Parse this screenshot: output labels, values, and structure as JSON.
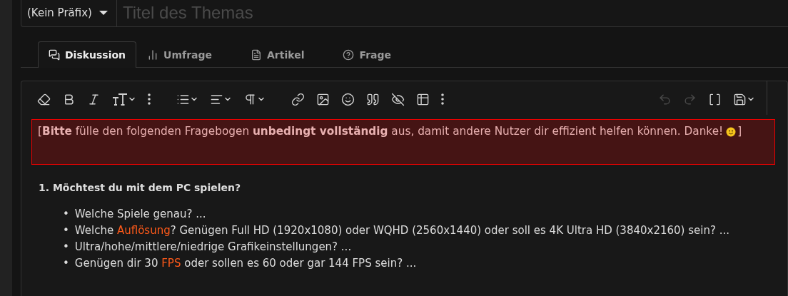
{
  "prefix_select": {
    "label": "(Kein Präfix)"
  },
  "title_field": {
    "placeholder": "Titel des Themas"
  },
  "tabs": [
    {
      "label": "Diskussion",
      "kind": "discussion",
      "selected": true
    },
    {
      "label": "Umfrage",
      "kind": "poll",
      "selected": false
    },
    {
      "label": "Artikel",
      "kind": "article",
      "selected": false
    },
    {
      "label": "Frage",
      "kind": "question",
      "selected": false
    }
  ],
  "toolbar_left": [
    {
      "kind": "eraser"
    },
    {
      "kind": "bold"
    },
    {
      "kind": "italic"
    },
    {
      "kind": "textsize",
      "dropdown": true
    },
    {
      "kind": "more"
    },
    {
      "kind": "gap"
    },
    {
      "kind": "list",
      "dropdown": true
    },
    {
      "kind": "align",
      "dropdown": true
    },
    {
      "kind": "paragraph",
      "dropdown": true
    },
    {
      "kind": "gap"
    },
    {
      "kind": "link"
    },
    {
      "kind": "image"
    },
    {
      "kind": "smile"
    },
    {
      "kind": "quote"
    },
    {
      "kind": "hide"
    },
    {
      "kind": "table"
    },
    {
      "kind": "more"
    }
  ],
  "toolbar_right": [
    {
      "kind": "undo",
      "disabled": true
    },
    {
      "kind": "redo",
      "disabled": true
    },
    {
      "kind": "brackets"
    },
    {
      "kind": "save",
      "dropdown": true
    }
  ],
  "notice": {
    "open": "[",
    "text": "**Bitte** fülle den folgenden Fragebogen **unbedingt vollständig** aus, damit andere Nutzer dir effizient helfen können. Danke!",
    "close": "]"
  },
  "heading": "1. Möchtest du mit dem PC spielen?",
  "bullets": [
    {
      "marker": "•",
      "segments": [
        {
          "text": "Welche Spiele genau? ...",
          "highlight": false
        }
      ]
    },
    {
      "marker": "•",
      "segments": [
        {
          "text": "Welche ",
          "highlight": false
        },
        {
          "text": "Auflösung",
          "highlight": true
        },
        {
          "text": "? Genügen Full HD (1920x1080) oder WQHD (2560x1440) oder soll es 4K Ultra HD (3840x2160) sein? ...",
          "highlight": false
        }
      ]
    },
    {
      "marker": "•",
      "segments": [
        {
          "text": "Ultra/hohe/mittlere/niedrige Grafikeinstellungen? ...",
          "highlight": false
        }
      ]
    },
    {
      "marker": "•",
      "segments": [
        {
          "text": "Genügen dir 30 ",
          "highlight": false
        },
        {
          "text": "FPS",
          "highlight": true
        },
        {
          "text": " oder sollen es 60 oder gar 144 FPS sein? ...",
          "highlight": false
        }
      ]
    }
  ]
}
